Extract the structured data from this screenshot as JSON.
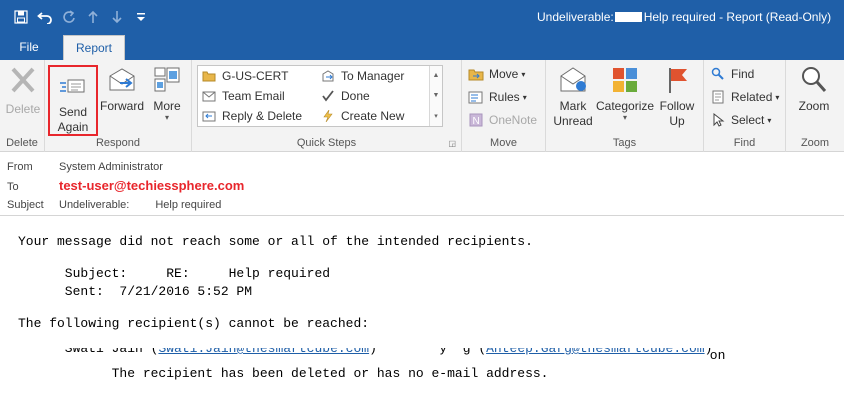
{
  "titlebar": {
    "title_prefix": "Undeliverable:",
    "title_suffix": "Help required - Report  (Read-Only)"
  },
  "tabs": [
    {
      "label": "File"
    },
    {
      "label": "Report"
    }
  ],
  "ribbon": {
    "delete": {
      "button": "Delete",
      "group": "Delete"
    },
    "respond": {
      "send_again": "Send\nAgain",
      "forward": "Forward",
      "more": "More",
      "group": "Respond"
    },
    "quick_steps": {
      "items": [
        "G-US-CERT",
        "To Manager",
        "Team Email",
        "Done",
        "Reply & Delete",
        "Create New"
      ],
      "group": "Quick Steps"
    },
    "move": {
      "move": "Move",
      "rules": "Rules",
      "onenote": "OneNote",
      "group": "Move"
    },
    "tags": {
      "mark_unread": "Mark\nUnread",
      "categorize": "Categorize",
      "follow_up": "Follow\nUp",
      "group": "Tags"
    },
    "find": {
      "find": "Find",
      "related": "Related",
      "select": "Select",
      "group": "Find"
    },
    "zoom": {
      "zoom": "Zoom",
      "group": "Zoom"
    }
  },
  "header": {
    "from_label": "From",
    "from_value": "System Administrator",
    "to_label": "To",
    "to_value": "test-user@techiessphere.com",
    "subject_label": "Subject",
    "subject_prefix": "Undeliverable:",
    "subject_suffix": "Help required"
  },
  "message": {
    "line1": "Your message did not reach some or all of the intended recipients.",
    "subject_line": "      Subject:     RE:     Help required",
    "sent_line": "      Sent:  7/21/2016 5:52 PM",
    "line4": "The following recipient(s) cannot be reached:",
    "recipient_name": "      Swati Jain ",
    "recipient_link1": "Swati.Jain@thesmartcube.com",
    "recipient_mid": "        y  g ",
    "recipient_link2": "Anteep.Garg@thesmartcube.com",
    "recipient_on": " on",
    "reason_line": "            The recipient has been deleted or has no e-mail address."
  }
}
